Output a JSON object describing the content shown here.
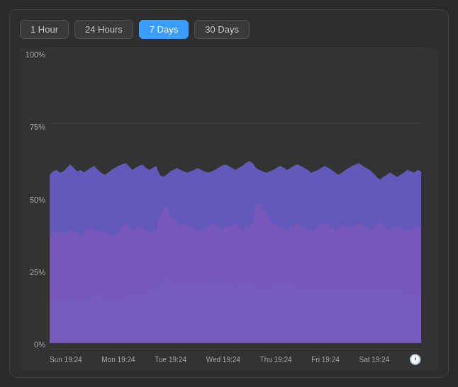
{
  "toolbar": {
    "tabs": [
      {
        "label": "1 Hour",
        "active": false
      },
      {
        "label": "24 Hours",
        "active": false
      },
      {
        "label": "7 Days",
        "active": true
      },
      {
        "label": "30 Days",
        "active": false
      }
    ]
  },
  "chart": {
    "y_labels": [
      "100%",
      "75%",
      "50%",
      "25%",
      "0%"
    ],
    "x_labels": [
      "Sun 19:24",
      "Mon 19:24",
      "Tue 19:24",
      "Wed 19:24",
      "Thu 19:24",
      "Fri 19:24",
      "Sat 19:24"
    ],
    "colors": {
      "blue": "#4a9fcc",
      "red": "#c0392b",
      "purple": "#6b5fd4"
    }
  }
}
